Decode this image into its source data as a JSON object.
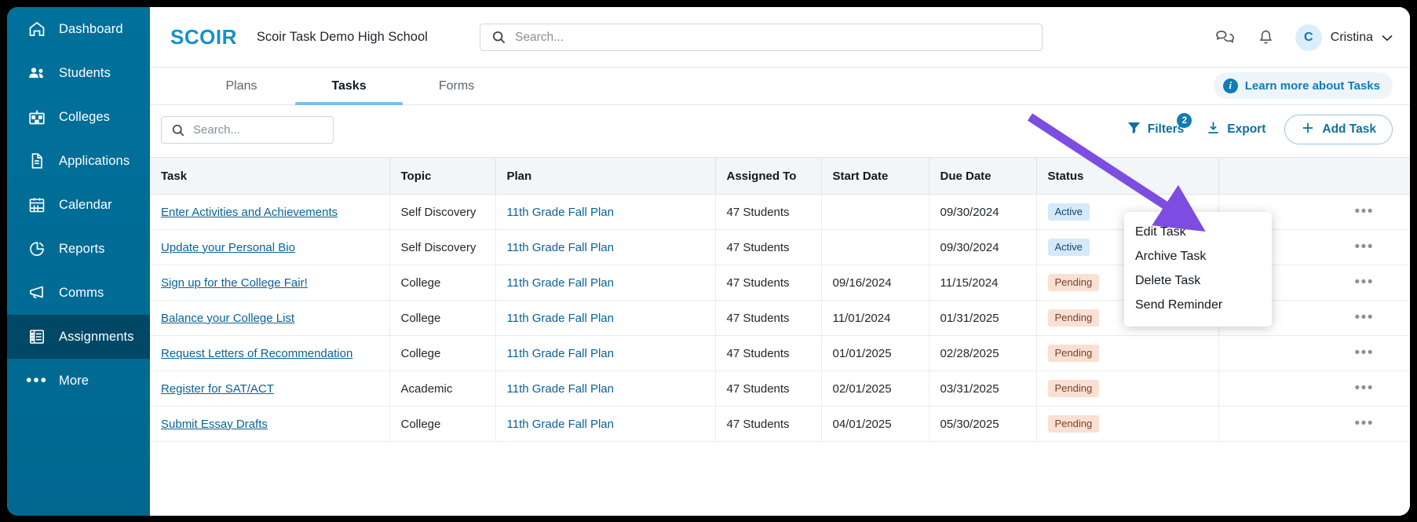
{
  "sidebar": {
    "items": [
      {
        "label": "Dashboard",
        "icon": "home-icon",
        "active": false
      },
      {
        "label": "Students",
        "icon": "students-icon",
        "active": false
      },
      {
        "label": "Colleges",
        "icon": "school-icon",
        "active": false
      },
      {
        "label": "Applications",
        "icon": "document-icon",
        "active": false
      },
      {
        "label": "Calendar",
        "icon": "calendar-icon",
        "active": false
      },
      {
        "label": "Reports",
        "icon": "pie-chart-icon",
        "active": false
      },
      {
        "label": "Comms",
        "icon": "megaphone-icon",
        "active": false
      },
      {
        "label": "Assignments",
        "icon": "list-icon",
        "active": true
      },
      {
        "label": "More",
        "icon": "ellipsis-icon",
        "active": false
      }
    ]
  },
  "header": {
    "logo": "SCOIR",
    "school_name": "Scoir Task Demo High School",
    "search_placeholder": "Search...",
    "messages_icon": "chat-bubbles-icon",
    "notifications_icon": "bell-icon",
    "avatar_initial": "C",
    "user_name": "Cristina",
    "user_chevron": "chevron-down-icon"
  },
  "tabs": [
    {
      "label": "Plans",
      "active": false
    },
    {
      "label": "Tasks",
      "active": true
    },
    {
      "label": "Forms",
      "active": false
    }
  ],
  "learn_more": {
    "label": "Learn more about Tasks",
    "icon": "info-icon"
  },
  "toolbar": {
    "search_placeholder": "Search...",
    "filters_label": "Filters",
    "filters_badge": "2",
    "filters_icon": "funnel-icon",
    "export_label": "Export",
    "export_icon": "download-icon",
    "add_task_label": "Add Task",
    "add_task_icon": "plus-icon"
  },
  "table": {
    "columns": [
      "Task",
      "Topic",
      "Plan",
      "Assigned To",
      "Start Date",
      "Due Date",
      "Status",
      ""
    ],
    "rows": [
      {
        "task": "Enter Activities and Achievements",
        "topic": "Self Discovery",
        "plan": "11th Grade Fall Plan",
        "assigned_to": "47 Students",
        "start_date": "",
        "due_date": "09/30/2024",
        "status": "Active",
        "status_kind": "active",
        "menu_icon": "ellipsis-icon"
      },
      {
        "task": "Update your Personal Bio",
        "topic": "Self Discovery",
        "plan": "11th Grade Fall Plan",
        "assigned_to": "47 Students",
        "start_date": "",
        "due_date": "09/30/2024",
        "status": "Active",
        "status_kind": "active",
        "menu_icon": "ellipsis-icon"
      },
      {
        "task": "Sign up for the College Fair!",
        "topic": "College",
        "plan": "11th Grade Fall Plan",
        "assigned_to": "47 Students",
        "start_date": "09/16/2024",
        "due_date": "11/15/2024",
        "status": "Pending",
        "status_kind": "pending",
        "menu_icon": "ellipsis-icon"
      },
      {
        "task": "Balance your College List",
        "topic": "College",
        "plan": "11th Grade Fall Plan",
        "assigned_to": "47 Students",
        "start_date": "11/01/2024",
        "due_date": "01/31/2025",
        "status": "Pending",
        "status_kind": "pending",
        "menu_icon": "ellipsis-icon"
      },
      {
        "task": "Request Letters of Recommendation",
        "topic": "College",
        "plan": "11th Grade Fall Plan",
        "assigned_to": "47 Students",
        "start_date": "01/01/2025",
        "due_date": "02/28/2025",
        "status": "Pending",
        "status_kind": "pending",
        "menu_icon": "ellipsis-icon"
      },
      {
        "task": "Register for SAT/ACT",
        "topic": "Academic",
        "plan": "11th Grade Fall Plan",
        "assigned_to": "47 Students",
        "start_date": "02/01/2025",
        "due_date": "03/31/2025",
        "status": "Pending",
        "status_kind": "pending",
        "menu_icon": "ellipsis-icon"
      },
      {
        "task": "Submit Essay Drafts",
        "topic": "College",
        "plan": "11th Grade Fall Plan",
        "assigned_to": "47 Students",
        "start_date": "04/01/2025",
        "due_date": "05/30/2025",
        "status": "Pending",
        "status_kind": "pending",
        "menu_icon": "ellipsis-icon"
      }
    ]
  },
  "context_menu": {
    "items": [
      "Edit Task",
      "Archive Task",
      "Delete Task",
      "Send Reminder"
    ]
  },
  "annotation": {
    "arrow_color": "#8košŸ"
  },
  "colors": {
    "sidebar": "#00688F",
    "sidebar_active": "#004865",
    "brand_blue": "#1590C8",
    "link_blue": "#0a6296",
    "accent_teal": "#0f7cb5",
    "tab_underline": "#7EBDEA",
    "badge_active_bg": "#d4e9fa",
    "badge_active_fg": "#17456e",
    "badge_pending_bg": "#fae0d2",
    "badge_pending_fg": "#74422a",
    "annotation_arrow": "#7C4DE0"
  }
}
